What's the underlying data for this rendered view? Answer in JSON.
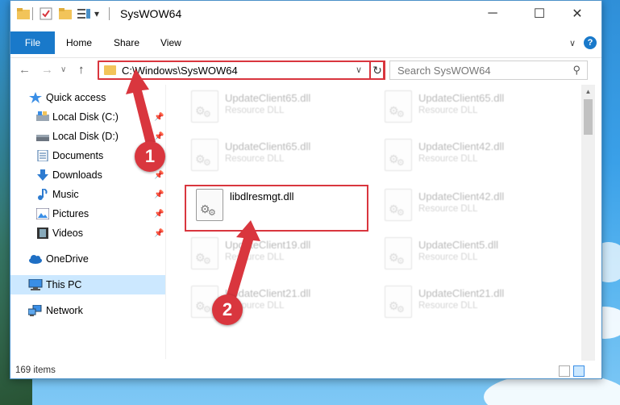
{
  "window": {
    "title": "SysWOW64",
    "minimize_glyph": "─",
    "maximize_glyph": "☐",
    "close_glyph": "✕",
    "qat_dropdown_glyph": "▾"
  },
  "ribbon": {
    "tabs": [
      "File",
      "Home",
      "Share",
      "View"
    ],
    "chevron": "∨",
    "help": "?"
  },
  "navigation": {
    "back": "←",
    "forward": "→",
    "recent": "∨",
    "up": "↑",
    "address": "C:\\Windows\\SysWOW64",
    "address_dropdown": "∨",
    "refresh": "↻",
    "search_placeholder": "Search SysWOW64",
    "search_icon": "⚲"
  },
  "sidebar": {
    "items": [
      {
        "label": "Quick access",
        "icon": "star-icon",
        "pinned": false
      },
      {
        "label": "Local Disk (C:)",
        "icon": "drive-icon",
        "pinned": true
      },
      {
        "label": "Local Disk (D:)",
        "icon": "drive-icon",
        "pinned": true
      },
      {
        "label": "Documents",
        "icon": "document-icon",
        "pinned": true
      },
      {
        "label": "Downloads",
        "icon": "download-icon",
        "pinned": true
      },
      {
        "label": "Music",
        "icon": "music-icon",
        "pinned": true
      },
      {
        "label": "Pictures",
        "icon": "picture-icon",
        "pinned": true
      },
      {
        "label": "Videos",
        "icon": "video-icon",
        "pinned": true
      },
      {
        "label": "OneDrive",
        "icon": "cloud-icon",
        "pinned": false
      },
      {
        "label": "This PC",
        "icon": "computer-icon",
        "pinned": false,
        "selected": true
      },
      {
        "label": "Network",
        "icon": "network-icon",
        "pinned": false
      }
    ],
    "pin_glyph": "📌"
  },
  "files": {
    "left": [
      {
        "name": "UpdateClient65.dll",
        "type": "Resource DLL"
      },
      {
        "name": "UpdateClient65.dll",
        "type": "Resource DLL"
      },
      {
        "name": "libdlresmgt.dll",
        "type": ""
      },
      {
        "name": "UpdateClient19.dll",
        "type": "Resource DLL"
      },
      {
        "name": "UpdateClient21.dll",
        "type": "Resource DLL"
      }
    ],
    "right": [
      {
        "name": "UpdateClient65.dll",
        "type": "Resource DLL"
      },
      {
        "name": "UpdateClient42.dll",
        "type": "Resource DLL"
      },
      {
        "name": "UpdateClient42.dll",
        "type": "Resource DLL"
      },
      {
        "name": "UpdateClient5.dll",
        "type": "Resource DLL"
      },
      {
        "name": "UpdateClient21.dll",
        "type": "Resource DLL"
      }
    ]
  },
  "status": {
    "item_count": "169 items"
  },
  "callouts": [
    "1",
    "2"
  ],
  "colors": {
    "accent": "#1979ca",
    "highlight": "#d9363e",
    "selected": "#cce8ff"
  }
}
